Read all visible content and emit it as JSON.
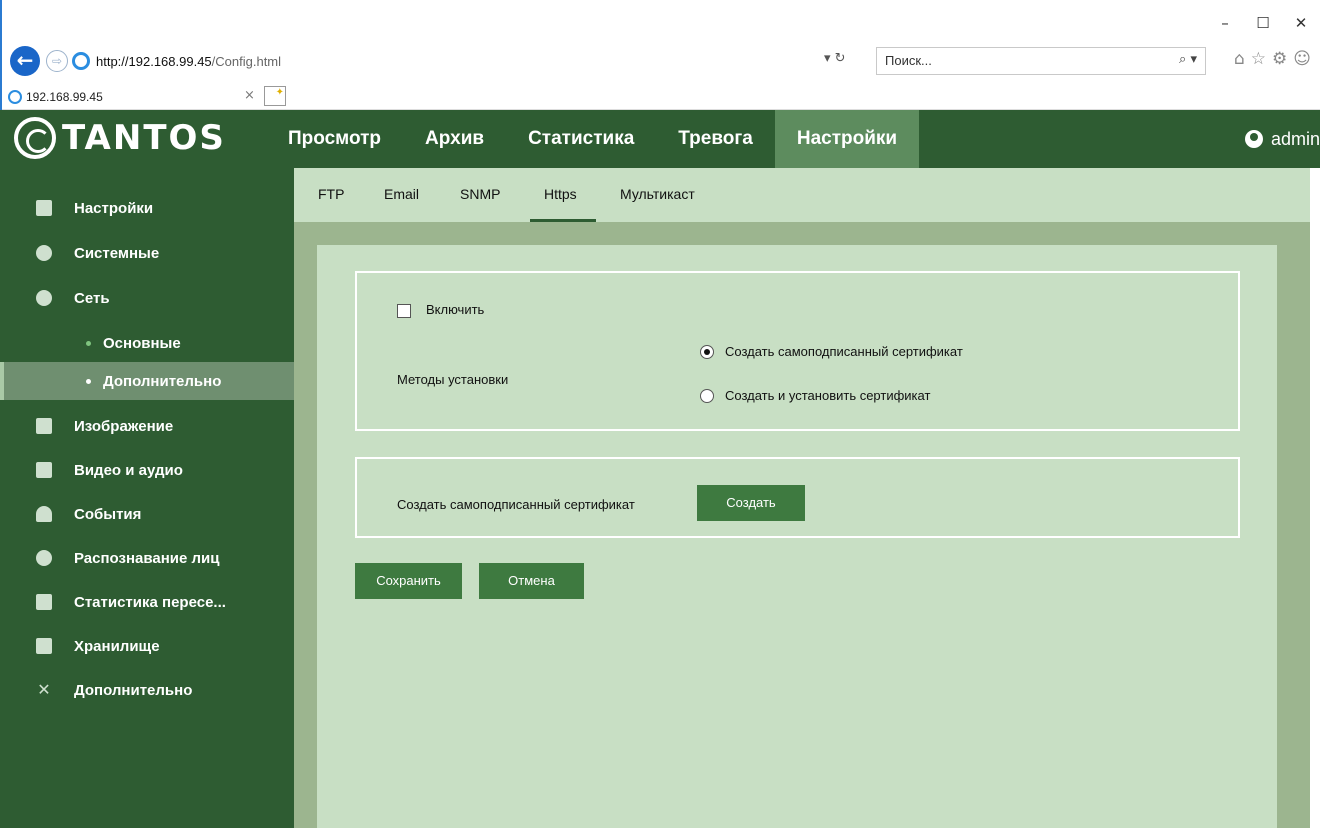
{
  "browser": {
    "window_controls": [
      "–",
      "☐",
      "✕"
    ],
    "url_host": "http://192.168.99.45",
    "url_path": "/Config.html",
    "addr_tools": "▾ ↻",
    "search_placeholder": "Поиск...",
    "search_glyph": "⌕ ▾",
    "fav_icons": "⌂☆⚙☺",
    "tab_title": "192.168.99.45",
    "tab_close": "×"
  },
  "header": {
    "logo_text": "TANTOS",
    "nav": [
      {
        "label": "Просмотр"
      },
      {
        "label": "Архив"
      },
      {
        "label": "Статистика"
      },
      {
        "label": "Тревога"
      },
      {
        "label": "Настройки",
        "active": true
      }
    ],
    "user": "admin"
  },
  "sidebar": {
    "items": [
      {
        "label": "Настройки",
        "icon": "monitor-icon"
      },
      {
        "label": "Системные",
        "icon": "info-icon"
      },
      {
        "label": "Сеть",
        "icon": "globe-icon"
      },
      {
        "label": "Основные",
        "sub": true
      },
      {
        "label": "Дополнительно",
        "sub": true,
        "active": true
      },
      {
        "label": "Изображение",
        "icon": "image-icon"
      },
      {
        "label": "Видео и аудио",
        "icon": "video-icon"
      },
      {
        "label": "События",
        "icon": "bell-icon"
      },
      {
        "label": "Распознавание лиц",
        "icon": "face-icon"
      },
      {
        "label": "Статистика пересе...",
        "icon": "bar-chart-icon"
      },
      {
        "label": "Хранилище",
        "icon": "floppy-icon"
      },
      {
        "label": "Дополнительно",
        "icon": "tools-icon"
      }
    ]
  },
  "subtabs": [
    "FTP",
    "Email",
    "SNMP",
    "Https",
    "Мультикаст"
  ],
  "active_subtab": "Https",
  "form": {
    "enable_label": "Включить",
    "enable_checked": false,
    "install_methods_label": "Методы установки",
    "radio_options": [
      "Создать  самоподписанный сертификат",
      "Создать и установить сертификат"
    ],
    "radio_selected": 0,
    "create_cert_label": "Создать  самоподписанный сертификат",
    "create_button": "Создать",
    "save_button": "Сохранить",
    "cancel_button": "Отмена"
  },
  "colors": {
    "header_green": "#2e5c32",
    "active_nav": "#5d8c5e",
    "content_bg": "#c8dfc4",
    "button_green": "#3e7a40"
  }
}
